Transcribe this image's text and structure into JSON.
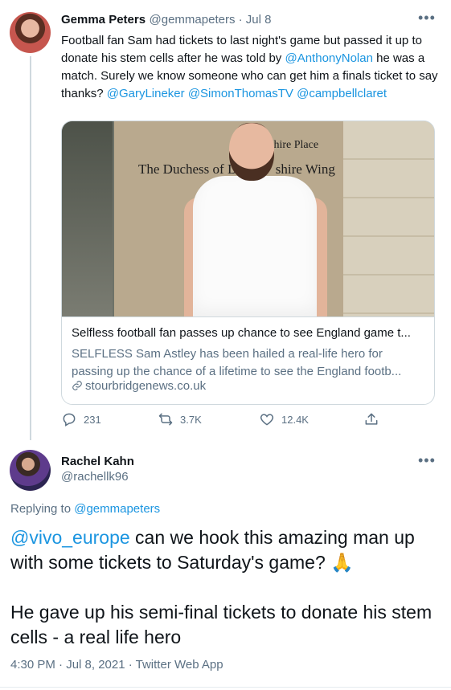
{
  "tweet1": {
    "author_name": "Gemma Peters",
    "author_handle": "@gemmapeters",
    "separator": " · ",
    "date": "Jul 8",
    "text_parts": [
      "Football fan Sam had tickets to last night's game but passed it up to donate his stem cells after he was told by ",
      "@AnthonyNolan",
      " he was a match. Surely we know someone who can get him a finals ticket to say thanks? ",
      "@GaryLineker",
      " ",
      "@SimonThomasTV",
      " ",
      "@campbellclaret"
    ],
    "card": {
      "image_sign_left": "The Duchess of De",
      "image_sign_right": "shire Wing",
      "image_sign_top": "shire Place",
      "title": "Selfless football fan passes up chance to see England game t...",
      "description_line1": "SELFLESS Sam Astley has been hailed a real-life hero for",
      "description_line2": "passing up the chance of a lifetime to see the England footb...",
      "domain": "stourbridgenews.co.uk"
    },
    "actions": {
      "replies": "231",
      "retweets": "3.7K",
      "likes": "12.4K"
    }
  },
  "tweet2": {
    "author_name": "Rachel Kahn",
    "author_handle": "@rachellk96",
    "replying_prefix": "Replying to ",
    "replying_to": "@gemmapeters",
    "mention": "@vivo_europe",
    "text_line1": " can we hook this amazing man up with some tickets to Saturday's game? ",
    "emoji": "🙏",
    "text_line2": "He gave up his semi-final tickets to donate his stem cells - a real life hero",
    "timestamp": "4:30 PM · Jul 8, 2021 · Twitter Web App"
  },
  "icons": {
    "more": "more-icon",
    "reply": "reply-icon",
    "retweet": "retweet-icon",
    "like": "like-icon",
    "share": "share-icon",
    "link": "link-icon"
  },
  "colors": {
    "link": "#1b95e0",
    "muted": "#5b7083",
    "border": "#cfd9de"
  }
}
